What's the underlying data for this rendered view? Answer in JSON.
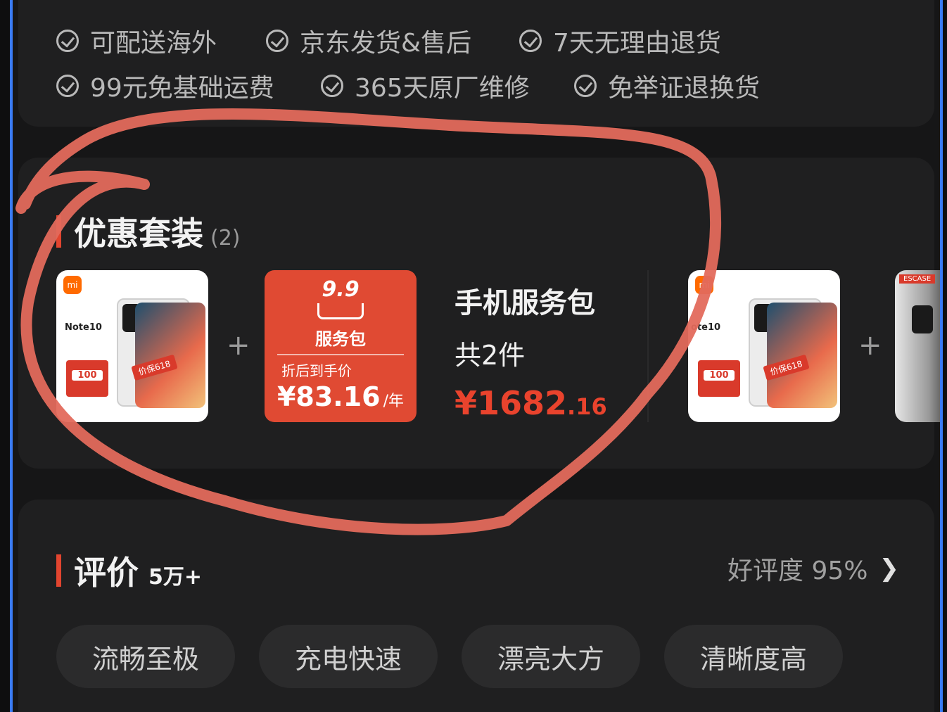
{
  "services": {
    "row1": [
      "可配送海外",
      "京东发货&售后",
      "7天无理由退货"
    ],
    "row2": [
      "99元免基础运费",
      "365天原厂维修",
      "免举证退换货"
    ]
  },
  "bundle": {
    "title": "优惠套装",
    "count": "(2)",
    "items": [
      {
        "phone_thumb": {
          "model": "Note10",
          "badge": "价保618",
          "coupon": "100",
          "logo": "mi"
        },
        "plus": "+",
        "service_pack": {
          "icon_label": "9.9",
          "title": "服务包",
          "subtitle": "折后到手价",
          "price": "¥83.16",
          "per": "/年"
        },
        "name": "手机服务包",
        "count": "共2件",
        "price_main": "¥1682",
        "price_cents": ".16"
      }
    ],
    "next_preview": {
      "model": "ote10",
      "badge": "价保618",
      "coupon": "100",
      "plus": "+",
      "case_label": "ESCASE"
    }
  },
  "reviews": {
    "title": "评价",
    "count": "5万+",
    "rating_label": "好评度 95%",
    "tags": [
      "流畅至极",
      "充电快速",
      "漂亮大方",
      "清晰度高"
    ]
  },
  "colors": {
    "accent": "#e9432d",
    "background": "#161617",
    "card": "#1f1f20",
    "annotation": "#e36a5c",
    "frame": "#3a7bf5"
  }
}
